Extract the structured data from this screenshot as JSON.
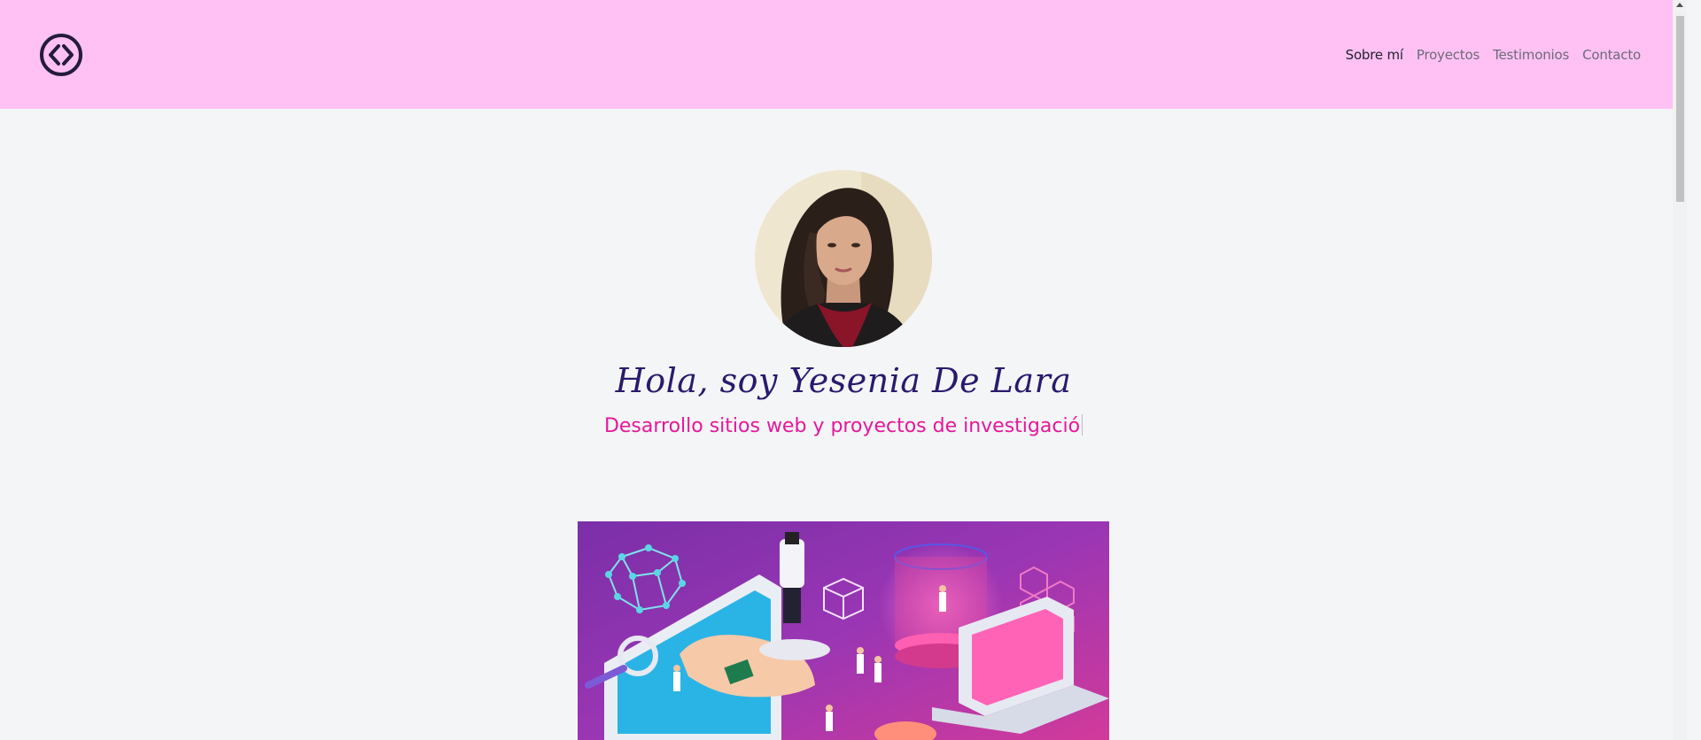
{
  "header": {
    "logo_icon": "code-brackets-icon",
    "nav": [
      {
        "label": "Sobre mí",
        "active": true
      },
      {
        "label": "Proyectos",
        "active": false
      },
      {
        "label": "Testimonios",
        "active": false
      },
      {
        "label": "Contacto",
        "active": false
      }
    ]
  },
  "hero": {
    "title": "Hola, soy Yesenia De Lara",
    "subtitle": "Desarrollo sitios web y proyectos de investigació"
  },
  "colors": {
    "header_bg": "#ffc1f4",
    "page_bg": "#f4f5f7",
    "title": "#2a1a6e",
    "subtitle": "#e5179a"
  }
}
